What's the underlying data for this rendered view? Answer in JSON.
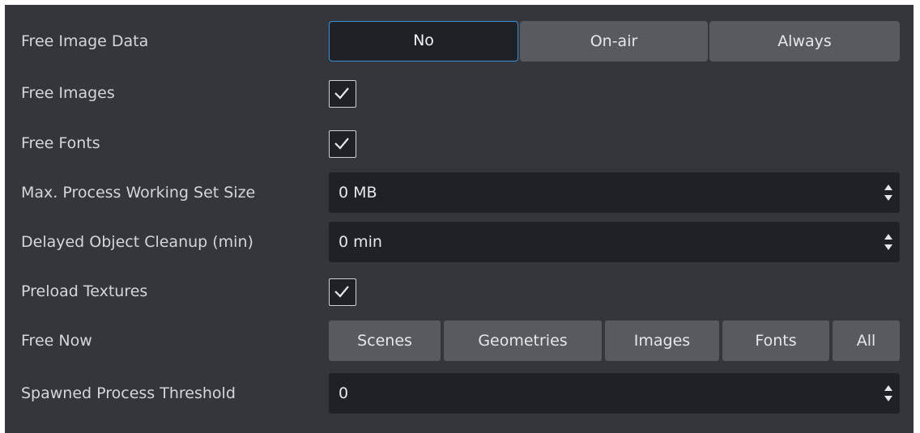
{
  "rows": {
    "free_image_data": {
      "label": "Free Image Data",
      "options": [
        "No",
        "On-air",
        "Always"
      ],
      "selected": "No"
    },
    "free_images": {
      "label": "Free Images",
      "checked": true
    },
    "free_fonts": {
      "label": "Free Fonts",
      "checked": true
    },
    "max_working_set": {
      "label": "Max. Process Working Set Size",
      "value": "0 MB"
    },
    "delayed_cleanup": {
      "label": "Delayed Object Cleanup (min)",
      "value": "0 min"
    },
    "preload_textures": {
      "label": "Preload Textures",
      "checked": true
    },
    "free_now": {
      "label": "Free Now",
      "buttons": [
        "Scenes",
        "Geometries",
        "Images",
        "Fonts",
        "All"
      ]
    },
    "spawned_threshold": {
      "label": "Spawned Process Threshold",
      "value": "0"
    }
  },
  "colors": {
    "panel_bg": "#33363a",
    "field_bg": "#1e2126",
    "button_bg": "#575a5e",
    "accent": "#3b8fd9",
    "text": "#d4d6d8"
  },
  "icons": {
    "checkbox": "checkmark-icon",
    "spinner": "up-down-arrows-icon"
  }
}
